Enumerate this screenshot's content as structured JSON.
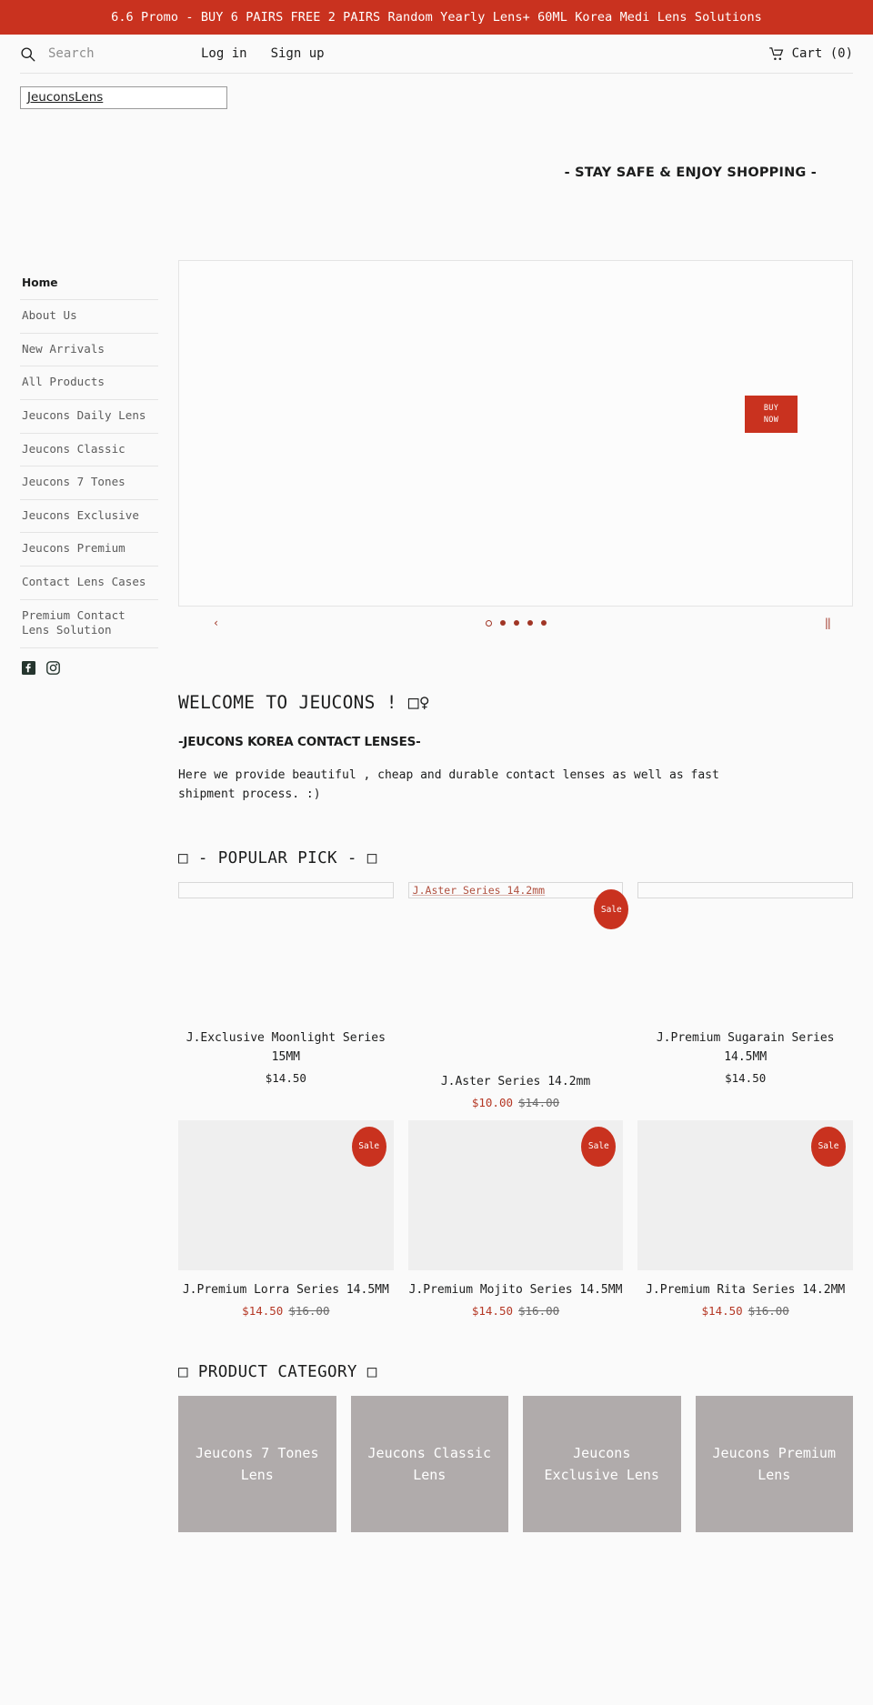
{
  "promo": {
    "text": "6.6 Promo - BUY 6 PAIRS FREE 2 PAIRS Random Yearly Lens+ 60ML Korea Medi Lens Solutions"
  },
  "header": {
    "search_placeholder": "Search",
    "login_label": "Log in",
    "signup_label": "Sign up",
    "cart_label": "Cart (0)"
  },
  "brand": {
    "logo_text": "JeuconsLens",
    "tagline": "- STAY SAFE & ENJOY SHOPPING -"
  },
  "sidebar": {
    "items": [
      {
        "label": "Home",
        "active": true
      },
      {
        "label": "About Us",
        "active": false
      },
      {
        "label": "New Arrivals",
        "active": false
      },
      {
        "label": "All Products",
        "active": false
      },
      {
        "label": "Jeucons Daily Lens",
        "active": false
      },
      {
        "label": "Jeucons Classic",
        "active": false
      },
      {
        "label": "Jeucons 7 Tones",
        "active": false
      },
      {
        "label": "Jeucons Exclusive",
        "active": false
      },
      {
        "label": "Jeucons Premium",
        "active": false
      },
      {
        "label": "Contact Lens Cases",
        "active": false
      },
      {
        "label": "Premium Contact Lens Solution",
        "active": false
      }
    ],
    "socials": [
      {
        "name": "facebook-icon"
      },
      {
        "name": "instagram-icon"
      }
    ]
  },
  "slideshow": {
    "buy_now_line1": "BUY",
    "buy_now_line2": "NOW",
    "prev_label": "‹",
    "next_label": "‖",
    "dots": [
      {
        "active": true
      },
      {
        "active": false
      },
      {
        "active": false
      },
      {
        "active": false
      },
      {
        "active": false
      }
    ]
  },
  "welcome": {
    "heading": "WELCOME TO JEUCONS ! □♀",
    "subheading": "-JEUCONS KOREA CONTACT LENSES-",
    "paragraph": "Here we provide beautiful , cheap and durable contact lenses as well as fast shipment process. :)"
  },
  "popular": {
    "heading": "□ - POPULAR PICK - □",
    "row1": [
      {
        "alt_text": "",
        "title": "J.Exclusive Moonlight Series 15MM",
        "price": "$14.50",
        "compare_at": "",
        "on_sale": false,
        "sale_label": ""
      },
      {
        "alt_text": "J.Aster Series 14.2mm",
        "title": "J.Aster Series 14.2mm",
        "price": "$10.00",
        "compare_at": "$14.00",
        "on_sale": true,
        "sale_label": "Sale"
      },
      {
        "alt_text": "",
        "title": "J.Premium Sugarain Series 14.5MM",
        "price": "$14.50",
        "compare_at": "",
        "on_sale": false,
        "sale_label": ""
      }
    ],
    "row2": [
      {
        "title": "J.Premium Lorra Series 14.5MM",
        "price": "$14.50",
        "compare_at": "$16.00",
        "on_sale": true,
        "sale_label": "Sale"
      },
      {
        "title": "J.Premium Mojito Series 14.5MM",
        "price": "$14.50",
        "compare_at": "$16.00",
        "on_sale": true,
        "sale_label": "Sale"
      },
      {
        "title": "J.Premium Rita Series 14.2MM",
        "price": "$14.50",
        "compare_at": "$16.00",
        "on_sale": true,
        "sale_label": "Sale"
      }
    ]
  },
  "category": {
    "heading": "□ PRODUCT CATEGORY □",
    "cards": [
      {
        "label": "Jeucons 7 Tones Lens"
      },
      {
        "label": "Jeucons Classic Lens"
      },
      {
        "label": "Jeucons Exclusive Lens"
      },
      {
        "label": "Jeucons Premium Lens"
      }
    ]
  },
  "colors": {
    "brand_red": "#c9321f",
    "sale_red": "#b53724",
    "category_gray": "#b0abab",
    "page_bg": "#fafafa"
  }
}
